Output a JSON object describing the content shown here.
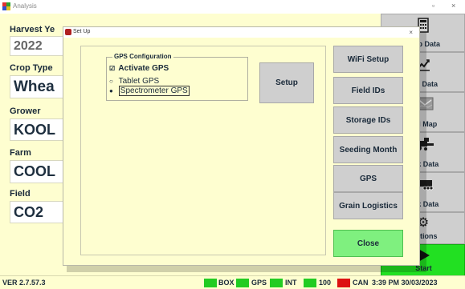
{
  "window": {
    "title": "Analysis",
    "minimize": "▫",
    "close": "×"
  },
  "fields": [
    {
      "label": "Harvest Ye",
      "value": "2022",
      "style": "grey"
    },
    {
      "label": "Crop Type",
      "value": "Whea",
      "style": "dark"
    },
    {
      "label": "Grower",
      "value": "KOOL",
      "style": "dark"
    },
    {
      "label": "Farm",
      "value": "COOL",
      "style": "dark"
    },
    {
      "label": "Field",
      "value": "CO2",
      "style": "dark"
    }
  ],
  "sidebar": {
    "items": [
      {
        "label": "etup Data",
        "icon": "calculator-icon"
      },
      {
        "label": "eld Data",
        "icon": "chart-icon"
      },
      {
        "label": "eld Map",
        "icon": "map-icon"
      },
      {
        "label": "ank Data",
        "icon": "combine-icon"
      },
      {
        "label": "uck Data",
        "icon": "truck-icon"
      },
      {
        "label": "Options",
        "icon": "gear-icon"
      },
      {
        "label": "Start",
        "icon": "play-icon"
      }
    ]
  },
  "status": {
    "version": "VER 2.7.57.3",
    "indicators": [
      {
        "label": "BOX",
        "color": "#22cc22"
      },
      {
        "label": "GPS",
        "color": "#22cc22"
      },
      {
        "label": "INT",
        "color": "#22cc22"
      },
      {
        "label": "100",
        "color": "#22cc22"
      },
      {
        "label": "CAN",
        "color": "#dd1111"
      }
    ],
    "datetime": "3:39 PM  30/03/2023"
  },
  "dialog": {
    "title": "Set Up",
    "close": "×",
    "group": {
      "legend": "GPS Configuration",
      "checkbox_label": "Activate GPS",
      "checkbox_mark": "☑",
      "radio_options": [
        {
          "label": "Tablet GPS",
          "mark": "○"
        },
        {
          "label": "Spectrometer GPS",
          "mark": "●"
        }
      ]
    },
    "setup_button": "Setup",
    "buttons": [
      "WiFi Setup",
      "Field IDs",
      "Storage IDs",
      "Seeding Month",
      "GPS",
      "Grain Logistics"
    ],
    "close_button": "Close"
  }
}
